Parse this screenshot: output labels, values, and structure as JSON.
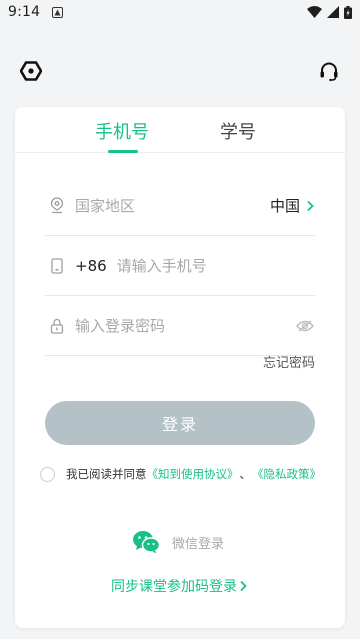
{
  "status_bar": {
    "time": "9:14",
    "icons": [
      "notification-icon",
      "wifi-icon",
      "signal-icon",
      "battery-icon"
    ]
  },
  "topbar": {
    "left_icon": "hexagon-logo-icon",
    "right_icon": "headset-support-icon"
  },
  "tabs": [
    {
      "label": "手机号",
      "active": true
    },
    {
      "label": "学号",
      "active": false
    }
  ],
  "form": {
    "region": {
      "placeholder": "国家地区",
      "value": "中国",
      "icon": "location-pin-icon"
    },
    "phone": {
      "country_code": "+86",
      "placeholder": "请输入手机号",
      "icon": "phone-icon"
    },
    "password": {
      "placeholder": "输入登录密码",
      "icon": "lock-icon",
      "toggle_icon": "eye-icon"
    },
    "forgot_label": "忘记密码"
  },
  "login_button": {
    "label": "登录"
  },
  "agreement": {
    "prefix": "我已阅读并同意",
    "terms_link": "《知到使用协议》",
    "separator": "、",
    "privacy_link": "《隐私政策》"
  },
  "wechat_login": {
    "label": "微信登录",
    "icon": "wechat-icon"
  },
  "sync_login": {
    "label": "同步课堂参加码登录"
  },
  "colors": {
    "accent": "#17c08a",
    "button_disabled": "#b4c2c7",
    "background": "#f2f4f5"
  }
}
